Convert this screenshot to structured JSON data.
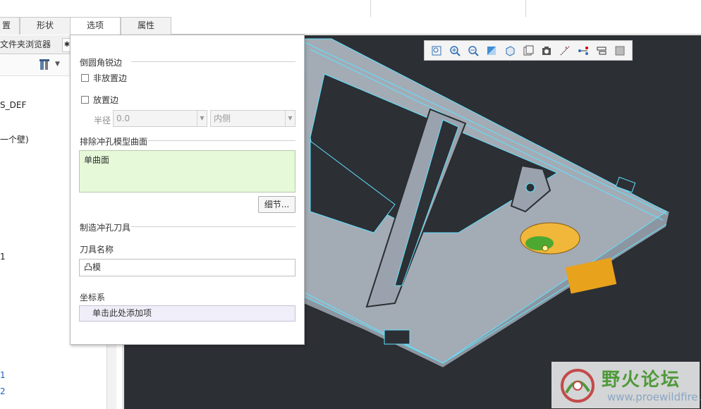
{
  "ribbon": {
    "tabs": [
      {
        "label": "置",
        "active": false
      },
      {
        "label": "形状",
        "active": false
      },
      {
        "label": "选项",
        "active": true
      },
      {
        "label": "属性",
        "active": false
      }
    ]
  },
  "left_pane": {
    "tabs": [
      "文件夹浏览器",
      "✱"
    ],
    "tree_items": [
      "S_DEF",
      "一个壁)",
      "1",
      "1",
      "2"
    ]
  },
  "options_panel": {
    "fillet_sharp_edges": {
      "title": "倒圆角锐边",
      "non_placement_edges_label": "非放置边",
      "non_placement_edges_checked": false,
      "placement_edges_label": "放置边",
      "placement_edges_checked": false,
      "radius_label": "半径",
      "radius_value": "0.0",
      "side_value": "内侧"
    },
    "exclude_surfaces": {
      "title": "排除冲孔模型曲面",
      "collector_value": "单曲面",
      "details_button": "细节..."
    },
    "make_tool": {
      "title": "制造冲孔刀具",
      "tool_name_label": "刀具名称",
      "tool_name_value": "凸模"
    },
    "coord_system": {
      "label": "坐标系",
      "collector_placeholder": "单击此处添加项"
    }
  },
  "view_toolbar": {
    "icons": [
      "refit-icon",
      "zoom-in-icon",
      "zoom-out-icon",
      "repaint-icon",
      "display-style-icon",
      "saved-views-icon",
      "view-manager-icon",
      "datum-display-icon",
      "spin-center-icon",
      "annotation-display-icon",
      "appearance-icon"
    ]
  },
  "watermark": {
    "title": "野火论坛",
    "url": "www.proewildfire.cn"
  },
  "colors": {
    "viewport_bg": "#2c2f34",
    "part_face": "#9aa3ad",
    "part_edge_highlight": "#5fe3ff",
    "selected_feature": "#e8a21c",
    "collector_active": "#e6f9d9"
  }
}
